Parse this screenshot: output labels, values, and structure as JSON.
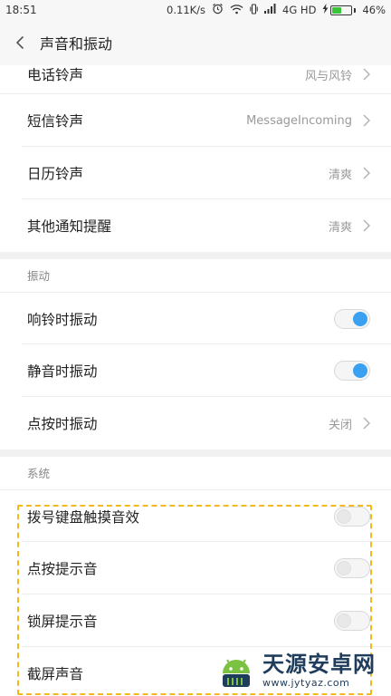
{
  "status_bar": {
    "time": "18:51",
    "speed": "0.11K/s",
    "network": "4G HD",
    "battery": "46%",
    "battery_level": 0.46
  },
  "header": {
    "title": "声音和振动"
  },
  "ringtones": [
    {
      "label": "电话铃声",
      "value": "风与风铃"
    },
    {
      "label": "短信铃声",
      "value": "MessageIncoming"
    },
    {
      "label": "日历铃声",
      "value": "清爽"
    },
    {
      "label": "其他通知提醒",
      "value": "清爽"
    }
  ],
  "vibration": {
    "heading": "振动",
    "ring_vibrate": {
      "label": "响铃时振动",
      "on": true
    },
    "silent_vibrate": {
      "label": "静音时振动",
      "on": true
    },
    "touch_vibrate": {
      "label": "点按时振动",
      "value": "关闭"
    }
  },
  "system": {
    "heading": "系统",
    "items": [
      {
        "label": "拨号键盘触摸音效",
        "on": false
      },
      {
        "label": "点按提示音",
        "on": false
      },
      {
        "label": "锁屏提示音",
        "on": false
      },
      {
        "label": "截屏声音"
      }
    ]
  },
  "watermark": {
    "main": "天源安卓网",
    "sub": "www.jytyaz.com"
  },
  "colors": {
    "toggle_on": "#3aa0f2",
    "highlight_border": "#f3b81c",
    "battery_fill": "#3ac43a"
  }
}
